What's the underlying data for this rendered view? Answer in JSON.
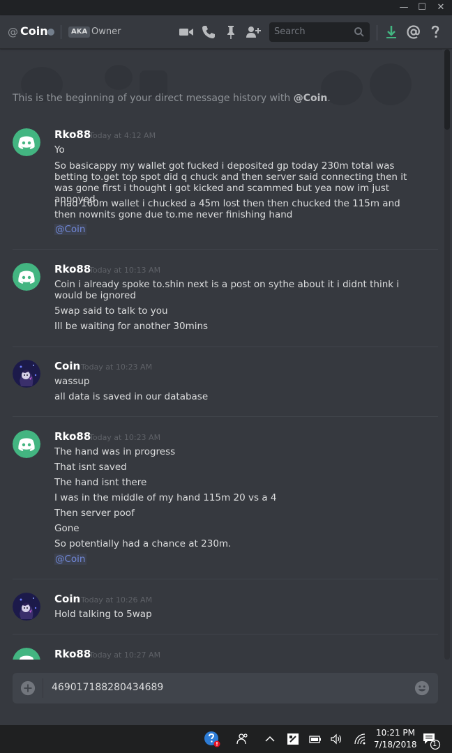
{
  "window": {
    "minimize_glyph": "—",
    "maximize_glyph": "☐",
    "close_glyph": "✕"
  },
  "header": {
    "at_symbol": "@",
    "channel_name": "Coin",
    "aka_badge": "AKA",
    "aka_name": "Owner",
    "search_placeholder": "Search",
    "icons": [
      "video-call-icon",
      "voice-call-icon",
      "pin-icon",
      "add-friend-icon",
      "search-icon",
      "download-icon",
      "mentions-icon",
      "help-icon"
    ]
  },
  "intro": {
    "prefix": "This is the beginning of your direct message history with ",
    "mention": "@Coin",
    "suffix": "."
  },
  "messages": [
    {
      "author": "Rko88",
      "timestamp": "Today at 4:12 AM",
      "avatar": "discord-default-avatar",
      "lines": [
        "Yo",
        "So basicappy my wallet got fucked i deposited gp today 230m total was betting to.get top spot did q chuck and then server said connecting then it was gone first i thought i got kicked and scammed but yea now im just annoyed",
        "I had 160m wallet i chucked a 45m lost then  then chucked the 115m and then nownits gone due to.me never finishing hand"
      ],
      "mention": "@Coin"
    },
    {
      "author": "Rko88",
      "timestamp": "Today at 10:13 AM",
      "avatar": "discord-default-avatar",
      "lines": [
        "Coin i already spoke to.shin next is a post on sythe about it i didnt think i would be ignored",
        "5wap said to talk to you",
        "Ill be waiting for another 30mins"
      ]
    },
    {
      "author": "Coin",
      "timestamp": "Today at 10:23 AM",
      "avatar": "coin-avatar",
      "lines": [
        "wassup",
        "all data is saved in our database"
      ]
    },
    {
      "author": "Rko88",
      "timestamp": "Today at 10:23 AM",
      "avatar": "discord-default-avatar",
      "lines": [
        "The hand was in progress",
        "That isnt saved",
        "The hand isnt there",
        "I was in the middle of my hand 115m 20 vs a 4",
        "Then server poof",
        "Gone",
        "So potentially had a chance at 230m."
      ],
      "mention": "@Coin"
    },
    {
      "author": "Coin",
      "timestamp": "Today at 10:26 AM",
      "avatar": "coin-avatar",
      "lines": [
        "Hold talking to 5wap"
      ]
    },
    {
      "author": "Rko88",
      "timestamp": "Today at 10:27 AM",
      "avatar": "discord-default-avatar",
      "lines": []
    }
  ],
  "composer": {
    "value": "469017188280434689",
    "icons": [
      "upload-plus-icon",
      "emoji-icon"
    ]
  },
  "taskbar": {
    "time": "10:21 PM",
    "date": "7/18/2018",
    "notification_count": "1",
    "icons": [
      "help-alert-icon",
      "people-icon",
      "chevron-up-icon",
      "app-icon",
      "battery-icon",
      "volume-icon",
      "wifi-icon",
      "action-center-icon"
    ]
  },
  "colors": {
    "background": "#36393f",
    "accent_green": "#43b581",
    "mention_blue": "#7289da",
    "download_green": "#43b581"
  }
}
